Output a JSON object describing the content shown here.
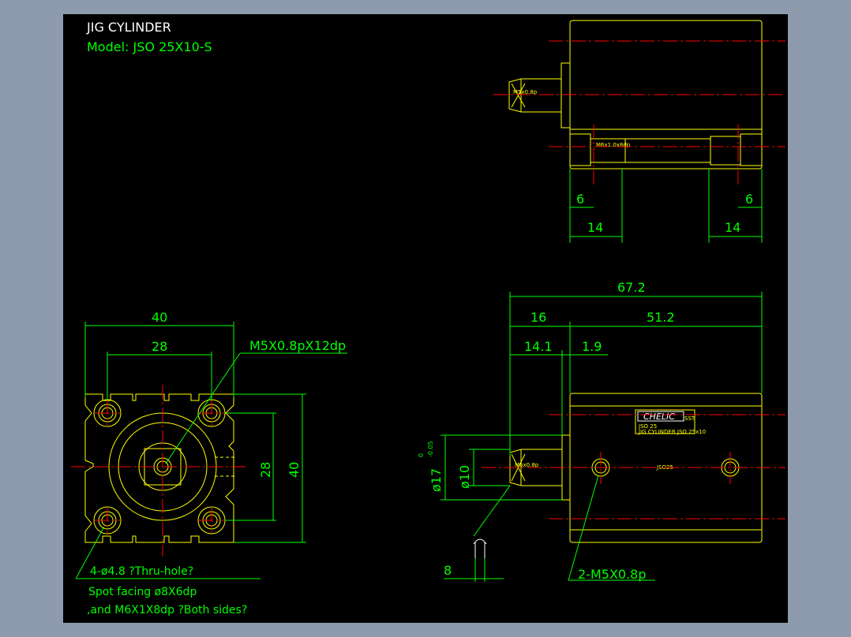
{
  "title": "JIG CYLINDER",
  "model": "Model:  JSO  25X10-S",
  "top_view": {
    "port_label": "M5x0.8p",
    "thread_label": "M6x1.0x8dp",
    "dim_left_small": "6",
    "dim_right_small": "6",
    "dim_left_large": "14",
    "dim_right_large": "14"
  },
  "front_view": {
    "dim_width_outer": "40",
    "dim_width_inner": "28",
    "callout_thread": "M5X0.8pX12dp",
    "dim_height_inner": "28",
    "dim_height_outer": "40",
    "note_line1": "4-ø4.8 ?Thru-hole?",
    "note_line2": "Spot facing  ø8X6dp",
    "note_line3": ",and M6X1X8dp ?Both sides?"
  },
  "side_view": {
    "dim_total": "67.2",
    "dim_rod": "16",
    "dim_body": "51.2",
    "dim_rod_a": "14.1",
    "dim_rod_b": "1.9",
    "dim_dia_17": "ø17",
    "tol_upper": "0",
    "tol_lower": "-0.05",
    "dim_dia_10": "ø10",
    "port_label": "M5x0.8p",
    "dim_8": "8",
    "callout_ports": "2-M5X0.8p",
    "brand": "CHELIC",
    "brand_suffix": "SST",
    "plate_line1": "JSO 25",
    "plate_line2": "JIG CYLINDER  JSO 25x10",
    "body_mark": "JSO25"
  }
}
